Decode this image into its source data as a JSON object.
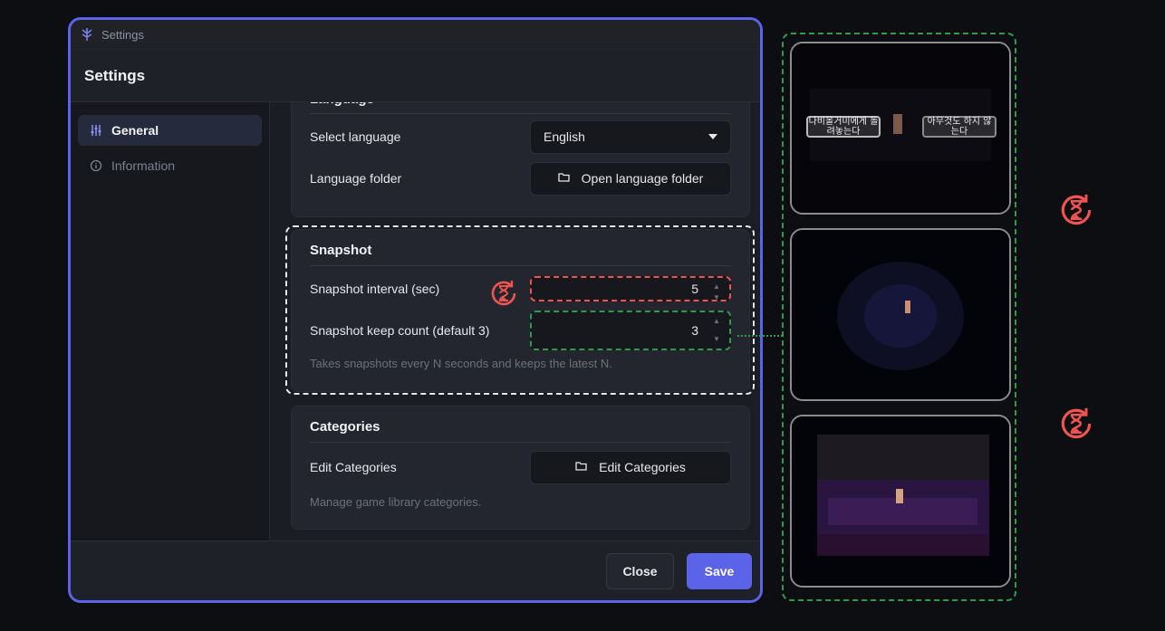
{
  "window": {
    "title": "Settings"
  },
  "dialog": {
    "title": "Settings"
  },
  "sidebar": {
    "items": [
      {
        "label": "General",
        "icon": "sliders-icon",
        "active": true
      },
      {
        "label": "Information",
        "icon": "info-icon",
        "active": false
      }
    ]
  },
  "language": {
    "title": "Language",
    "select_label": "Select language",
    "selected": "English",
    "folder_label": "Language folder",
    "folder_button": "Open language folder"
  },
  "snapshot": {
    "title": "Snapshot",
    "interval_label": "Snapshot interval (sec)",
    "interval_value": "5",
    "keep_label": "Snapshot keep count (default 3)",
    "keep_value": "3",
    "hint": "Takes snapshots every N seconds and keeps the latest N."
  },
  "categories": {
    "title": "Categories",
    "edit_label": "Edit Categories",
    "edit_button": "Edit Categories",
    "hint": "Manage game library categories."
  },
  "footer": {
    "close": "Close",
    "save": "Save"
  },
  "previews": {
    "choice_left": "나비올거미에게 \n돌려놓는다",
    "choice_right": "아무것도 하지 않는다"
  },
  "colors": {
    "accent": "#5b63e8",
    "highlight_red": "#f0544f",
    "highlight_green": "#2f9a47"
  }
}
